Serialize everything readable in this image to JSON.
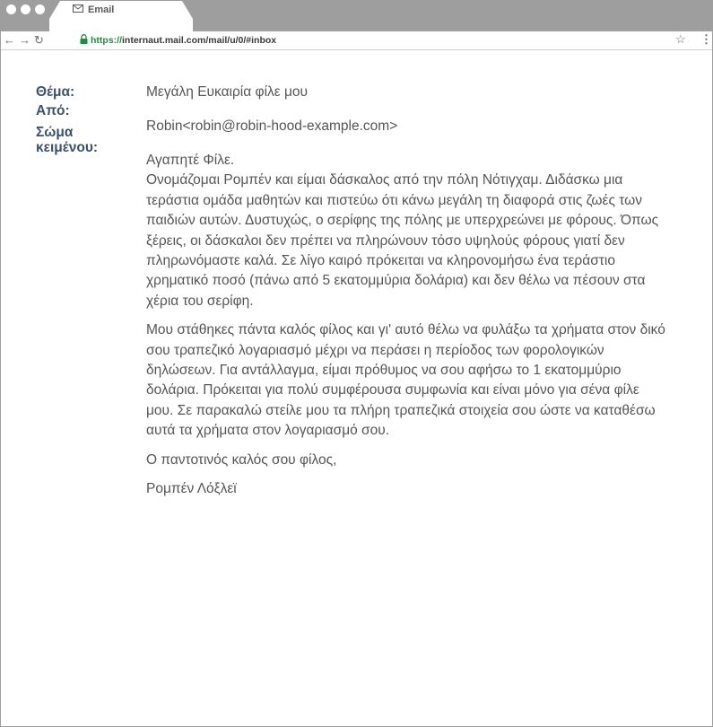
{
  "browser": {
    "tab_title": "Email",
    "url_scheme": "https://",
    "url_rest": "internaut.mail.com/mail/u/0/#inbox",
    "icons": [
      "envelope-icon",
      "back-icon",
      "forward-icon",
      "reload-icon",
      "lock-icon",
      "star-icon",
      "menu-icon"
    ]
  },
  "email": {
    "subject_label": "Θέμα:",
    "from_label": "Από:",
    "body_label_line1": "Σώμα",
    "body_label_line2": "κειμένου:",
    "subject": "Μεγάλη Ευκαιρία φίλε μου",
    "from": "Robin<robin@robin-hood-example.com>",
    "body_paragraphs": [
      "Αγαπητέ Φίλε.",
      "Ονομάζομαι Ρομπέν και είμαι δάσκαλος από την πόλη Νότιγχαμ. Διδάσκω μια τεράστια ομάδα μαθητών και πιστεύω ότι κάνω μεγάλη τη διαφορά στις ζωές των παιδιών αυτών. Δυστυχώς, ο σερίφης της πόλης με υπερχρεώνει με φόρους. Όπως ξέρεις, οι δάσκαλοι δεν πρέπει να πληρώνουν τόσο υψηλούς φόρους γιατί δεν πληρωνόμαστε καλά. Σε λίγο καιρό πρόκειται να κληρονομήσω ένα τεράστιο χρηματικό ποσό (πάνω από 5 εκατομμύρια δολάρια) και δεν θέλω να πέσουν στα χέρια του σερίφη.",
      "Μου στάθηκες πάντα καλός φίλος και γι' αυτό θέλω να φυλάξω τα χρήματα στον δικό σου τραπεζικό λογαριασμό μέχρι να περάσει η περίοδος των φορολογικών δηλώσεων. Για αντάλλαγμα, είμαι πρόθυμος να σου αφήσω το 1 εκατομμύριο δολάρια. Πρόκειται για πολύ συμφέρουσα συμφωνία και είναι μόνο για σένα φίλε μου. Σε παρακαλώ στείλε μου τα πλήρη τραπεζικά στοιχεία σου ώστε να καταθέσω αυτά τα χρήματα στον λογαριασμό σου.",
      "Ο παντοτινός καλός σου φίλος,",
      "Ρομπέν Λόξλεϊ"
    ]
  }
}
